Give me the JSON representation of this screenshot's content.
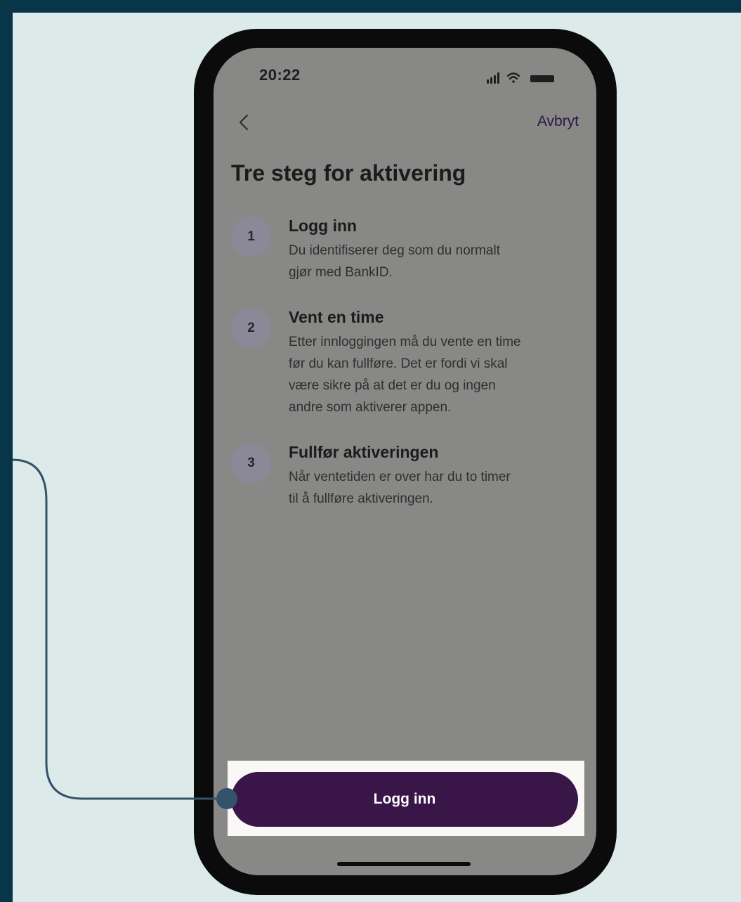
{
  "status_bar": {
    "time": "20:22"
  },
  "nav": {
    "cancel_label": "Avbryt"
  },
  "page": {
    "title": "Tre steg for aktivering"
  },
  "steps": [
    {
      "number": "1",
      "title": "Logg inn",
      "lines": [
        "Du identifiserer deg som du normalt",
        "gjør med BankID."
      ]
    },
    {
      "number": "2",
      "title": "Vent en time",
      "lines": [
        "Etter innloggingen må du vente en time",
        "før du kan fullføre. Det er fordi vi skal",
        "være sikre på at det er du og ingen",
        "andre som aktiverer appen."
      ]
    },
    {
      "number": "3",
      "title": "Fullfør aktiveringen",
      "lines": [
        "Når ventetiden er over har du to timer",
        "til å fullføre aktiveringen."
      ]
    }
  ],
  "primary_button": {
    "label": "Logg inn"
  },
  "colors": {
    "frame": "#083547",
    "background": "#dcebea",
    "screen_overlay": "#888887",
    "button": "#3a1548",
    "highlight": "#faf7f7",
    "connector": "#34536a"
  },
  "icons": [
    "signal-icon",
    "wifi-icon",
    "battery-icon",
    "back-chevron-icon"
  ]
}
